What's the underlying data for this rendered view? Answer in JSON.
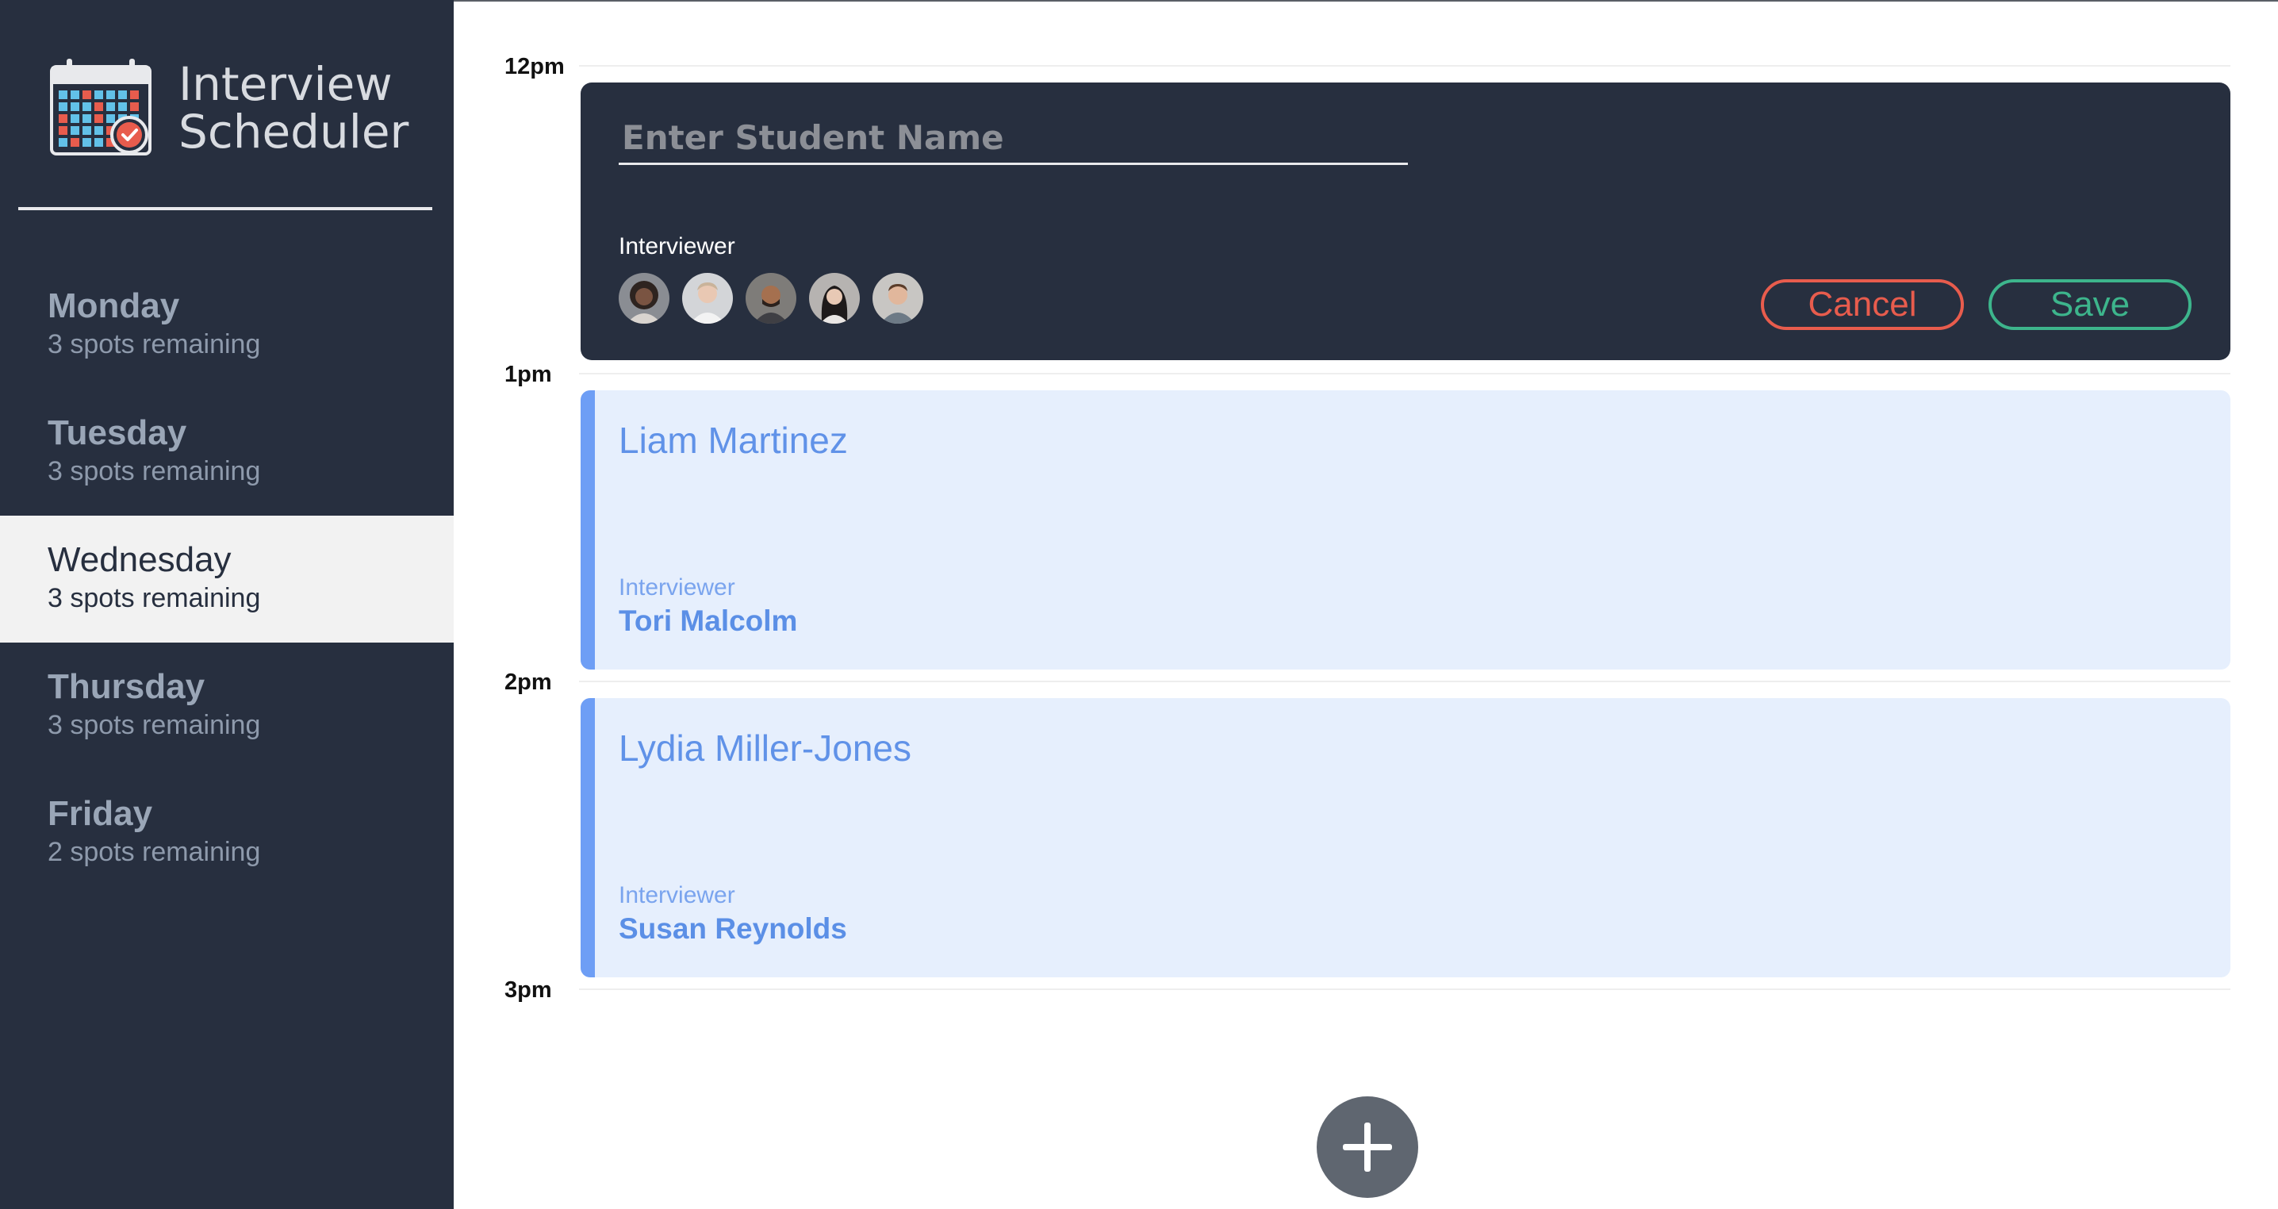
{
  "app": {
    "title_line1": "Interview",
    "title_line2": "Scheduler"
  },
  "sidebar": {
    "days": [
      {
        "name": "Monday",
        "spots": "3 spots remaining",
        "selected": false
      },
      {
        "name": "Tuesday",
        "spots": "3 spots remaining",
        "selected": false
      },
      {
        "name": "Wednesday",
        "spots": "3 spots remaining",
        "selected": true
      },
      {
        "name": "Thursday",
        "spots": "3 spots remaining",
        "selected": false
      },
      {
        "name": "Friday",
        "spots": "2 spots remaining",
        "selected": false
      }
    ]
  },
  "schedule": {
    "times": [
      "12pm",
      "1pm",
      "2pm",
      "3pm"
    ],
    "form": {
      "student_placeholder": "Enter Student Name",
      "student_value": "",
      "interviewer_label": "Interviewer",
      "avatars": [
        "interviewer-avatar-1",
        "interviewer-avatar-2",
        "interviewer-avatar-3",
        "interviewer-avatar-4",
        "interviewer-avatar-5"
      ],
      "cancel_label": "Cancel",
      "save_label": "Save"
    },
    "appointments": [
      {
        "student": "Liam Martinez",
        "interviewer_label": "Interviewer",
        "interviewer": "Tori Malcolm"
      },
      {
        "student": "Lydia Miller-Jones",
        "interviewer_label": "Interviewer",
        "interviewer": "Susan Reynolds"
      }
    ]
  },
  "colors": {
    "sidebar_bg": "#272f3f",
    "selected_bg": "#f2f2f2",
    "appointment_bg": "#e6effd",
    "appointment_accent": "#6e9ef5",
    "cancel": "#e85c4d",
    "save": "#3db58c"
  }
}
